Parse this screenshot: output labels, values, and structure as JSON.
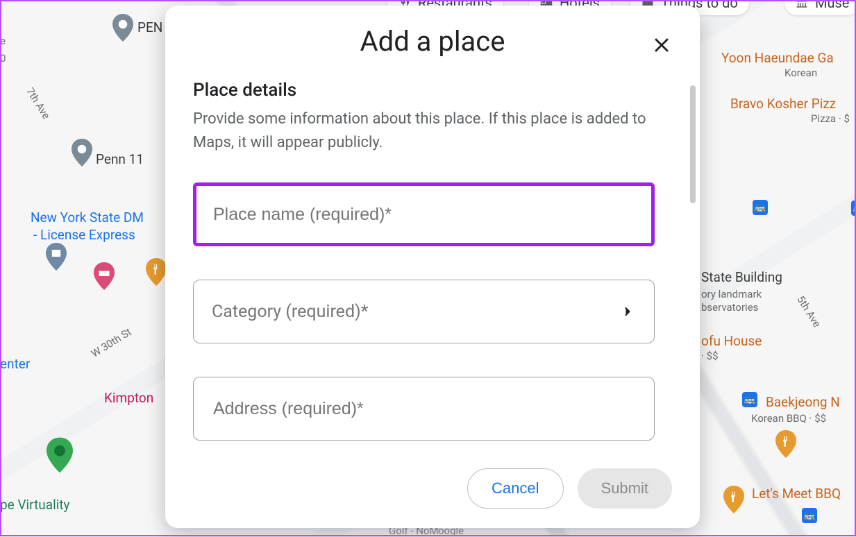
{
  "map": {
    "chips": {
      "restaurants": "Restaurants",
      "hotels": "Hotels",
      "things": "Things to do",
      "muse": "Muse"
    },
    "labels": {
      "penn": "PEN",
      "penn11": "Penn 11",
      "nys_dmv_1": "New York State DM",
      "nys_dmv_2": "- License Express",
      "w30": "W 30th St",
      "seventh": "7th Ave",
      "fifth": "5th Ave",
      "kimpton": "Kimpton",
      "virtuality": "pe Virtuality",
      "enter": "enter",
      "golf": "Golf - NoM",
      "empire_1": "State Building",
      "empire_2": "ory landmark",
      "empire_3": "bservatories",
      "tofu_1": "ofu House",
      "tofu_2": "· $$",
      "yoon_1": "Yoon Haeundae Ga",
      "yoon_2": "Korean",
      "bravo_1": "Bravo Kosher Pizz",
      "bravo_2": "Pizza · $",
      "baek_1": "Baekjeong N",
      "baek_2": "Korean BBQ · $$",
      "lets": "Let's Meet BBQ",
      "oogle": "oogle",
      "e": "e",
      "zero": "0"
    }
  },
  "modal": {
    "title": "Add a place",
    "section_title": "Place details",
    "section_desc": "Provide some information about this place. If this place is added to Maps, it will appear publicly.",
    "place_name_placeholder": "Place name (required)*",
    "category_placeholder": "Category (required)*",
    "address_placeholder": "Address (required)*",
    "cancel": "Cancel",
    "submit": "Submit"
  }
}
